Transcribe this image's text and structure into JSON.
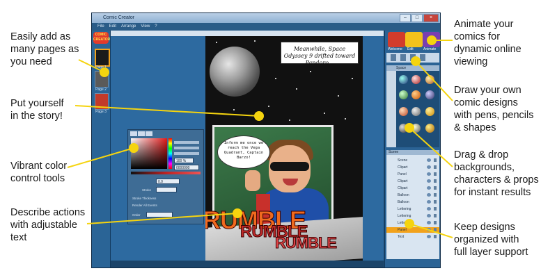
{
  "callouts": {
    "pages": "Easily add as\nmany pages as\nyou need",
    "yourself": "Put yourself\nin the story!",
    "color": "Vibrant color\ncontrol tools",
    "text": "Describe actions\nwith adjustable\ntext",
    "animate": "Animate your\ncomics for\ndynamic online\nviewing",
    "draw": "Draw your own\ncomic designs\nwith pens, pencils\n& shapes",
    "drag": "Drag & drop\nbackgrounds,\ncharacters & props\nfor instant results",
    "layers": "Keep designs\norganized with\nfull layer support"
  },
  "window": {
    "title": "Comic Creator",
    "menu": [
      "File",
      "Edit",
      "Arrange",
      "View",
      "?"
    ],
    "logo": "COMIC CREATOR",
    "pages": [
      "Page 1",
      "Page 2",
      "Page 3"
    ]
  },
  "comic": {
    "caption": "Meanwhile, Space Odyssey 9 drifted toward Pandoro...",
    "speech": "Inform me once we reach the Vega Quadrant, Captain Barzo!",
    "rumble": [
      "RUMBLE",
      "RUMBLE",
      "RUMBLE"
    ]
  },
  "color_panel": {
    "hex": "0000000",
    "percent": "100 %",
    "value_field": "0.0",
    "labels": [
      "Stroke",
      "Stroke Thickness",
      "Render All Events",
      "Order"
    ]
  },
  "right_panel": {
    "tabs": [
      "Welcome",
      "Edit",
      "Animate"
    ],
    "library_category": "Space",
    "layers_title": "Scene",
    "layers": [
      "Scene",
      "Clipart",
      "Panel",
      "Clipart",
      "Clipart",
      "Balloon",
      "Balloon",
      "Lettering",
      "Lettering",
      "Lettering",
      "Panel",
      "Text"
    ]
  },
  "colors": {
    "window_bg": "#1d4a73",
    "accent_orange": "#f2a21c",
    "rumble_orange": "#f06a1e",
    "rumble_red": "#c12a2a",
    "callout_line": "#f5d40f"
  },
  "icons": [
    "minimize-icon",
    "maximize-icon",
    "close-icon",
    "pen-icon",
    "pencil-icon",
    "text-tool-icon",
    "eye-icon",
    "lock-icon"
  ]
}
